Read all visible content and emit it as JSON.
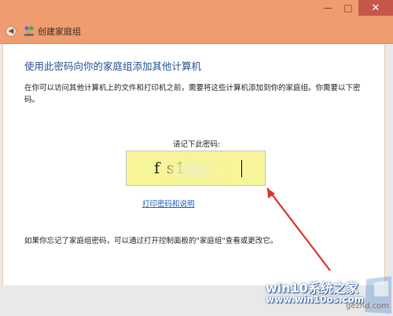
{
  "window": {
    "title": "创建家庭组",
    "controls": {
      "minimize": "—",
      "maximize": "□",
      "close": "✕"
    },
    "back_icon": "back-arrow-icon",
    "app_icon": "homegroup-icon"
  },
  "main": {
    "heading": "使用此密码向你的家庭组添加其他计算机",
    "description": "在你可以访问其他计算机上的文件和打印机之前，需要将这些计算机添加到你的家庭组。你需要以下密码。",
    "password_prompt": "请记下此密码:",
    "password_visible": "f        s1",
    "print_link": "打印密码和说明",
    "footer_note": "如果你忘记了家庭组密码，可以通过打开控制面板的\"家庭组\"查看或更改它。"
  },
  "watermark": {
    "line1": "win10系统之家",
    "line2": "www.win10os.com",
    "corner": "gezhd.com"
  },
  "colors": {
    "titlebar": "#ef9c6f",
    "heading": "#1f4e96",
    "link": "#1a5fb4",
    "password_box": "#f6f59a",
    "annotation_arrow": "#d9352b"
  }
}
